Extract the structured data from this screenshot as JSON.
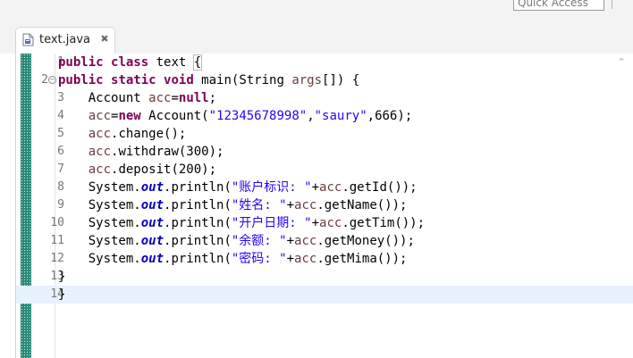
{
  "toolbar": {
    "quick_access_label": "Quick Access"
  },
  "tab": {
    "title": "text.java",
    "close_label": "✖",
    "file_icon": "java-file-icon"
  },
  "editor": {
    "current_line": 14,
    "lines": [
      {
        "number": "1",
        "text": "public class text {"
      },
      {
        "number": "2",
        "text": "public static void main(String args[]) {"
      },
      {
        "number": "3",
        "text": "    Account acc=null;"
      },
      {
        "number": "4",
        "text": "    acc=new Account(\"12345678998\",\"saury\",666);"
      },
      {
        "number": "5",
        "text": "    acc.change();"
      },
      {
        "number": "6",
        "text": "    acc.withdraw(300);"
      },
      {
        "number": "7",
        "text": "    acc.deposit(200);"
      },
      {
        "number": "8",
        "text": "    System.out.println(\"账户标识: \"+acc.getId());"
      },
      {
        "number": "9",
        "text": "    System.out.println(\"姓名: \"+acc.getName());"
      },
      {
        "number": "10",
        "text": "    System.out.println(\"开户日期: \"+acc.getTim());"
      },
      {
        "number": "11",
        "text": "    System.out.println(\"余额: \"+acc.getMoney());"
      },
      {
        "number": "12",
        "text": "    System.out.println(\"密码: \"+acc.getMima());"
      },
      {
        "number": "13",
        "text": "}"
      },
      {
        "number": "14",
        "text": "}"
      }
    ]
  },
  "syntax_colors": {
    "keyword": "#7f0055",
    "variable": "#6a3e3e",
    "string": "#2a00ff",
    "field": "#0000c0",
    "current_line_bg": "#e8f2fe"
  }
}
